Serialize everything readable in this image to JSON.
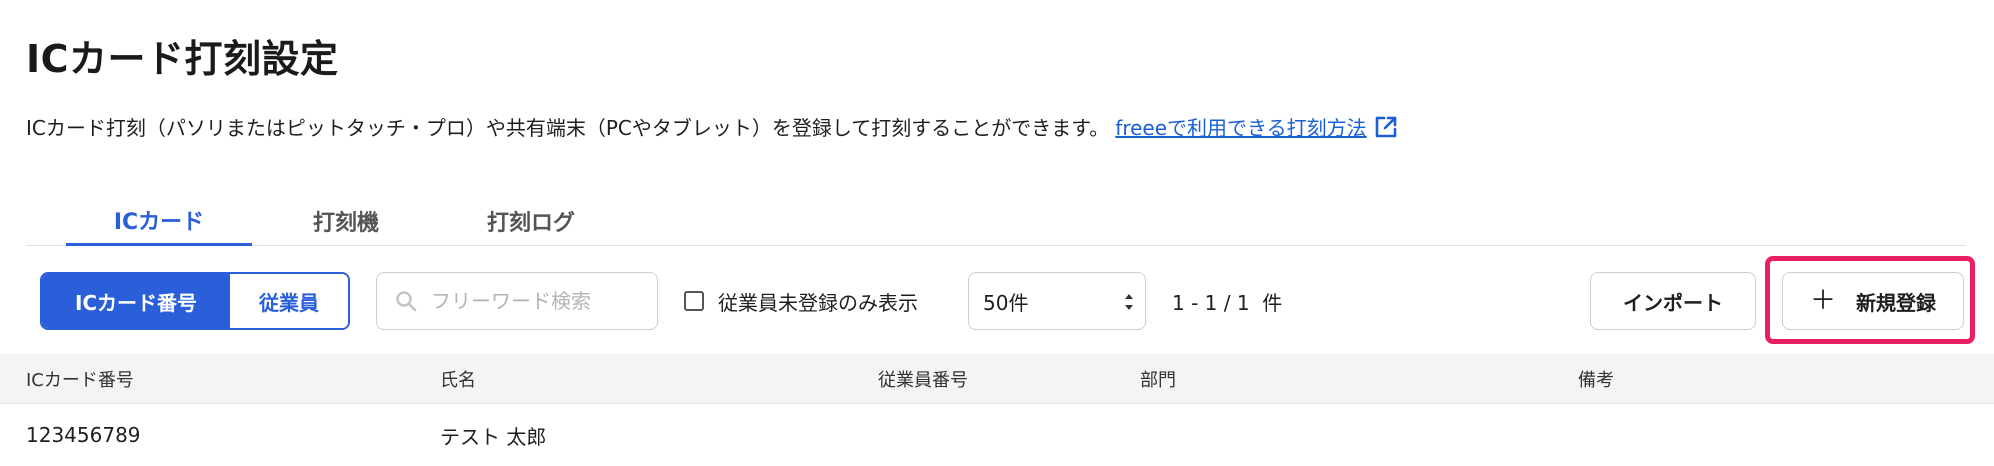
{
  "page": {
    "title": "ICカード打刻設定",
    "description": "ICカード打刻（パソリまたはピットタッチ・プロ）や共有端末（PCやタブレット）を登録して打刻することができます。",
    "help_link": "freeeで利用できる打刻方法"
  },
  "tabs": [
    {
      "label": "ICカード",
      "active": true
    },
    {
      "label": "打刻機",
      "active": false
    },
    {
      "label": "打刻ログ",
      "active": false
    }
  ],
  "toolbar": {
    "segment": {
      "options": [
        "ICカード番号",
        "従業員"
      ],
      "selected": "ICカード番号"
    },
    "search": {
      "placeholder": "フリーワード検索",
      "value": ""
    },
    "filter_checkbox": {
      "label": "従業員未登録のみ表示",
      "checked": false
    },
    "page_size": {
      "selected": "50件"
    },
    "count_text": "1 - 1 / 1  件",
    "import_label": "インポート",
    "new_label": "新規登録"
  },
  "table": {
    "columns": [
      "ICカード番号",
      "氏名",
      "従業員番号",
      "部門",
      "備考"
    ],
    "rows": [
      [
        "123456789",
        "テスト 太郎",
        "",
        "",
        ""
      ]
    ]
  },
  "colors": {
    "accent": "#2b5fd9",
    "highlight": "#ea1f63",
    "link": "#1a5fd6"
  },
  "icons": {
    "external_link": "external-link-icon",
    "search": "search-icon",
    "plus": "plus-icon",
    "select_arrows": "select-arrows-icon"
  }
}
